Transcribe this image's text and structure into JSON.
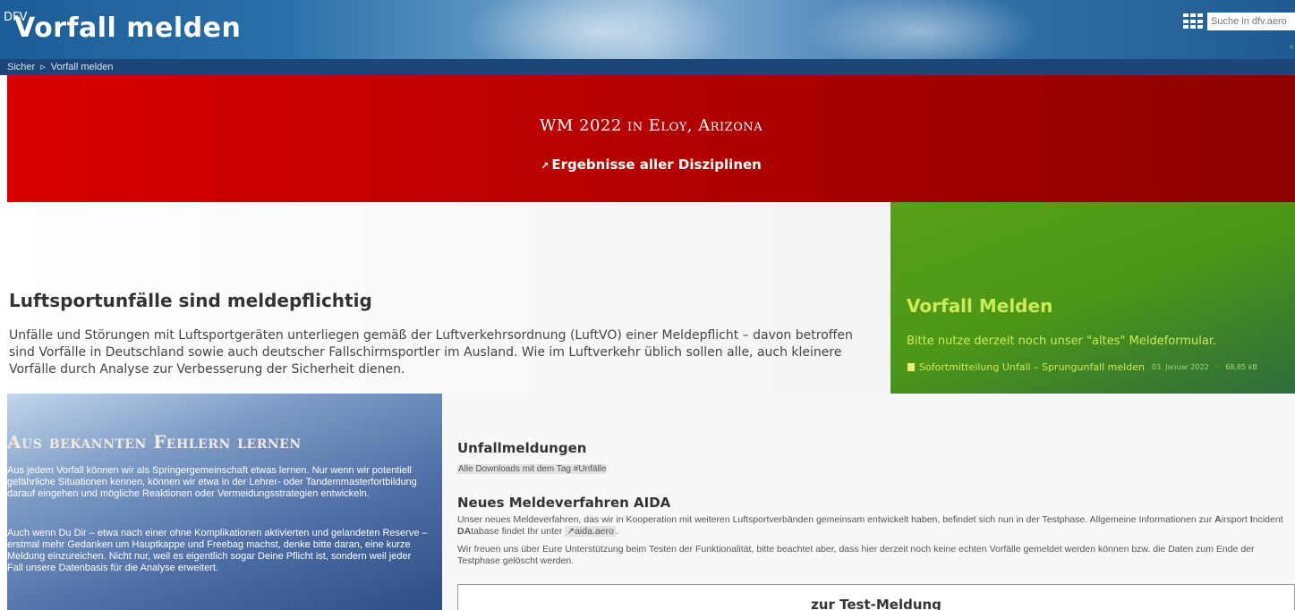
{
  "header": {
    "logo_text": "DFV",
    "title": "Vorfall melden",
    "search_placeholder": "Suche in dfv.aero"
  },
  "breadcrumb": {
    "items": [
      "Sicher",
      "Vorfall melden"
    ],
    "separator": "▹"
  },
  "banner": {
    "title": "WM 2022 in Eloy, Arizona",
    "link_label": "Ergebnisse aller Disziplinen",
    "colors": [
      "#d90000",
      "#8c0000"
    ]
  },
  "info": {
    "heading": "Luftsportunfälle sind meldepflichtig",
    "text": "Unfälle und Störungen mit Luftsportgeräten unterliegen gemäß der Luftverkehrsordnung (LuftVO) einer Meldepflicht – davon betroffen sind Vorfälle in Deutschland sowie auch deutscher Fallschirmsportler im Ausland. Wie im Luftverkehr üblich sollen alle, auch kleinere Vorfälle durch Analyse zur Verbesserung der Sicherheit dienen."
  },
  "green_box": {
    "title": "Vorfall Melden",
    "subtitle": "Bitte nutze derzeit noch unser \"altes\" Meldeformular.",
    "download_label": "Sofortmitteilung Unfall – Sprungunfall melden",
    "download_date": "03. Januar 2022",
    "download_size": "68,85 kB",
    "accent_color": "#cdea58"
  },
  "learn_panel": {
    "title": "Aus bekannten Fehlern lernen",
    "p1": "Aus jedem Vorfall können wir als Springergemeinschaft etwas lernen. Nur wenn wir potentiell gefährliche Situationen kennen, können wir etwa in der Lehrer- oder Tandemmasterfortbildung darauf eingehen und mögliche Reaktionen oder Vermeidungsstrategien entwickeln.",
    "p2": "Auch wenn Du Dir – etwa nach einer ohne Komplikationen aktivierten und gelandeten Reserve – erstmal mehr Gedanken um Hauptkappe und Freebag machst, denke bitte  daran, eine kurze Meldung einzureichen. Nicht nur, weil es eigentlich sogar Deine Pflicht ist, sondern weil jeder Fall unsere Datenbasis für die Analyse erweitert."
  },
  "unfallmeldungen": {
    "title": "Unfallmeldungen",
    "tag_text": "Alle Downloads mit dem Tag #Unfälle"
  },
  "aida": {
    "title": "Neues Meldeverfahren AIDA",
    "p1_prefix": "Unser neues Meldeverfahren, das wir in Kooperation mit weiteren Luftsportverbänden gemeinsam entwickelt haben, befindet sich nun in der Testphase. Allgemeine Informationen zur ",
    "p1_a": "A",
    "p1_airport": "irsport ",
    "p1_i": "I",
    "p1_incident": "ncident ",
    "p1_da": "DA",
    "p1_tabase": "tabase findet Ihr unter ",
    "link": "aida.aero",
    "p1_suffix": ".",
    "p2": "Wir freuen uns über Eure Unterstützung beim Testen der Funktionalität, bitte beachtet aber, dass hier derzeit noch keine echten Vorfälle gemeldet werden können bzw. die Daten zum Ende der Testphase gelöscht werden.",
    "button_label": "zur Test-Meldung"
  }
}
